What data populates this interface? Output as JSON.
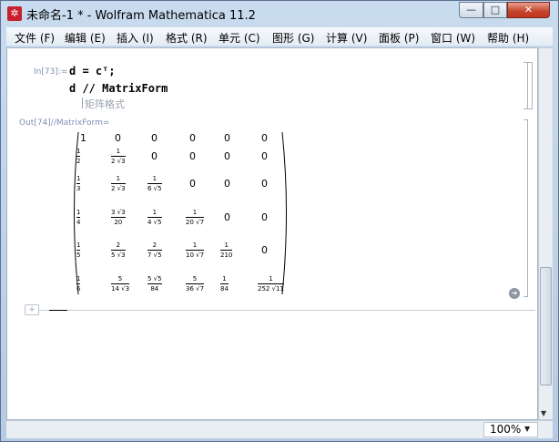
{
  "window": {
    "title": "未命名-1 * - Wolfram Mathematica 11.2",
    "min_label": "—",
    "max_label": "□",
    "close_label": "✕",
    "app_icon_glyph": "✲"
  },
  "menu": [
    "文件 (F)",
    "编辑 (E)",
    "插入 (I)",
    "格式 (R)",
    "单元 (C)",
    "图形 (G)",
    "计算 (V)",
    "面板 (P)",
    "窗口 (W)",
    "帮助 (H)"
  ],
  "notebook": {
    "in_label": "In[73]:=",
    "input_line1": "d = cᵀ;",
    "input_line2": "d // MatrixForm",
    "suggestion": "矩阵格式",
    "out_label": "Out[74]//MatrixForm=",
    "new_cell_plus": "+",
    "output_menu_glyph": "➔"
  },
  "matrix": [
    [
      {
        "t": "1"
      },
      {
        "t": "0"
      },
      {
        "t": "0"
      },
      {
        "t": "0"
      },
      {
        "t": "0"
      },
      {
        "t": "0"
      }
    ],
    [
      {
        "n": "1",
        "d": "2"
      },
      {
        "n": "1",
        "d": "2 √3"
      },
      {
        "t": "0"
      },
      {
        "t": "0"
      },
      {
        "t": "0"
      },
      {
        "t": "0"
      }
    ],
    [
      {
        "n": "1",
        "d": "3"
      },
      {
        "n": "1",
        "d": "2 √3"
      },
      {
        "n": "1",
        "d": "6 √5"
      },
      {
        "t": "0"
      },
      {
        "t": "0"
      },
      {
        "t": "0"
      }
    ],
    [
      {
        "n": "1",
        "d": "4"
      },
      {
        "n": "3 √3",
        "d": "20"
      },
      {
        "n": "1",
        "d": "4 √5"
      },
      {
        "n": "1",
        "d": "20 √7"
      },
      {
        "t": "0"
      },
      {
        "t": "0"
      }
    ],
    [
      {
        "n": "1",
        "d": "5"
      },
      {
        "n": "2",
        "d": "5 √3"
      },
      {
        "n": "2",
        "d": "7 √5"
      },
      {
        "n": "1",
        "d": "10 √7"
      },
      {
        "n": "1",
        "d": "210"
      },
      {
        "t": "0"
      }
    ],
    [
      {
        "n": "1",
        "d": "6"
      },
      {
        "n": "5",
        "d": "14 √3"
      },
      {
        "n": "5 √5",
        "d": "84"
      },
      {
        "n": "5",
        "d": "36 √7"
      },
      {
        "n": "1",
        "d": "84"
      },
      {
        "n": "1",
        "d": "252 √11"
      }
    ]
  ],
  "status": {
    "zoom": "100%",
    "zoom_arrow": "▼"
  },
  "scroll_arrow": "▼"
}
